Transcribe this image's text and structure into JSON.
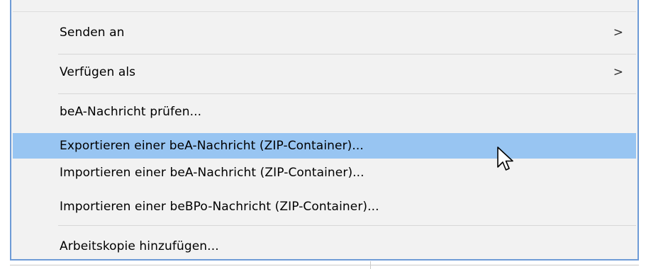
{
  "menu": {
    "items": [
      {
        "label": "Senden an",
        "submenu_indicator": ">"
      },
      {
        "label": "Verfügen als",
        "submenu_indicator": ">"
      },
      {
        "label": "beA-Nachricht prüfen..."
      },
      {
        "label": "Exportieren einer beA-Nachricht (ZIP-Container)...",
        "state": "selected"
      },
      {
        "label": "Importieren einer beA-Nachricht (ZIP-Container)..."
      },
      {
        "label": "Importieren einer beBPo-Nachricht (ZIP-Container)..."
      },
      {
        "label": "Arbeitskopie hinzufügen..."
      }
    ],
    "colors": {
      "highlight": "#98c5f2",
      "background": "#f2f2f2",
      "border": "#6e9bd6"
    }
  },
  "cursor": {
    "icon": "mouse-pointer-icon"
  }
}
